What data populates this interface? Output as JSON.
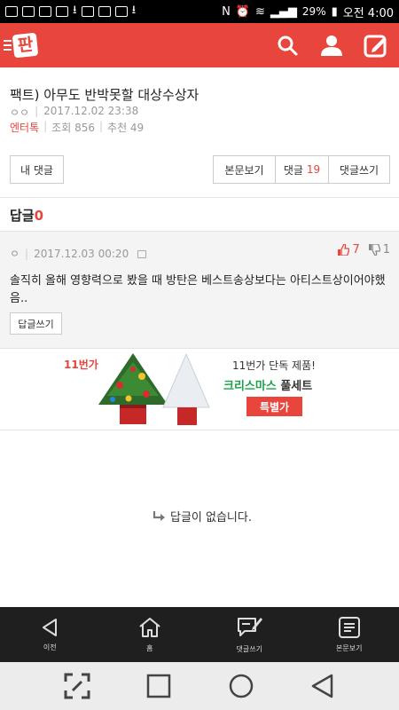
{
  "status_bar": {
    "battery": "29%",
    "time": "오전 4:00"
  },
  "header": {
    "logo_text": "판"
  },
  "post": {
    "title": "팩트) 아무도 반박못할 대상수상자",
    "author": "ㅇㅇ",
    "date": "2017.12.02 23:38",
    "category": "엔터톡",
    "views": "조회 856",
    "recommends": "추천 49"
  },
  "buttons": {
    "my_comments": "내 댓글",
    "view_body": "본문보기",
    "comments_label": "댓글",
    "comments_count": "19",
    "write_comment": "댓글쓰기"
  },
  "reply_header": {
    "label": "답글",
    "count": "0"
  },
  "comment": {
    "author": "ㅇ",
    "date": "2017.12.03 00:20",
    "likes": "7",
    "dislikes": "1",
    "text": "솔직히 올해 영향력으로 봤을 때 방탄은 베스트송상보다는 아티스트상이어야했음..",
    "reply_button": "답글쓰기"
  },
  "ad": {
    "brand": "11번가",
    "line1": "11번가 단독 제품!",
    "line2_green": "크리스마스",
    "line2_dark": "풀세트",
    "badge": "특별가"
  },
  "empty_state": {
    "text": "답글이 없습니다."
  },
  "bottom_nav": [
    {
      "label": "이전",
      "icon": "back-icon"
    },
    {
      "label": "홈",
      "icon": "home-icon"
    },
    {
      "label": "댓글쓰기",
      "icon": "write-comment-icon"
    },
    {
      "label": "본문보기",
      "icon": "document-icon"
    }
  ]
}
